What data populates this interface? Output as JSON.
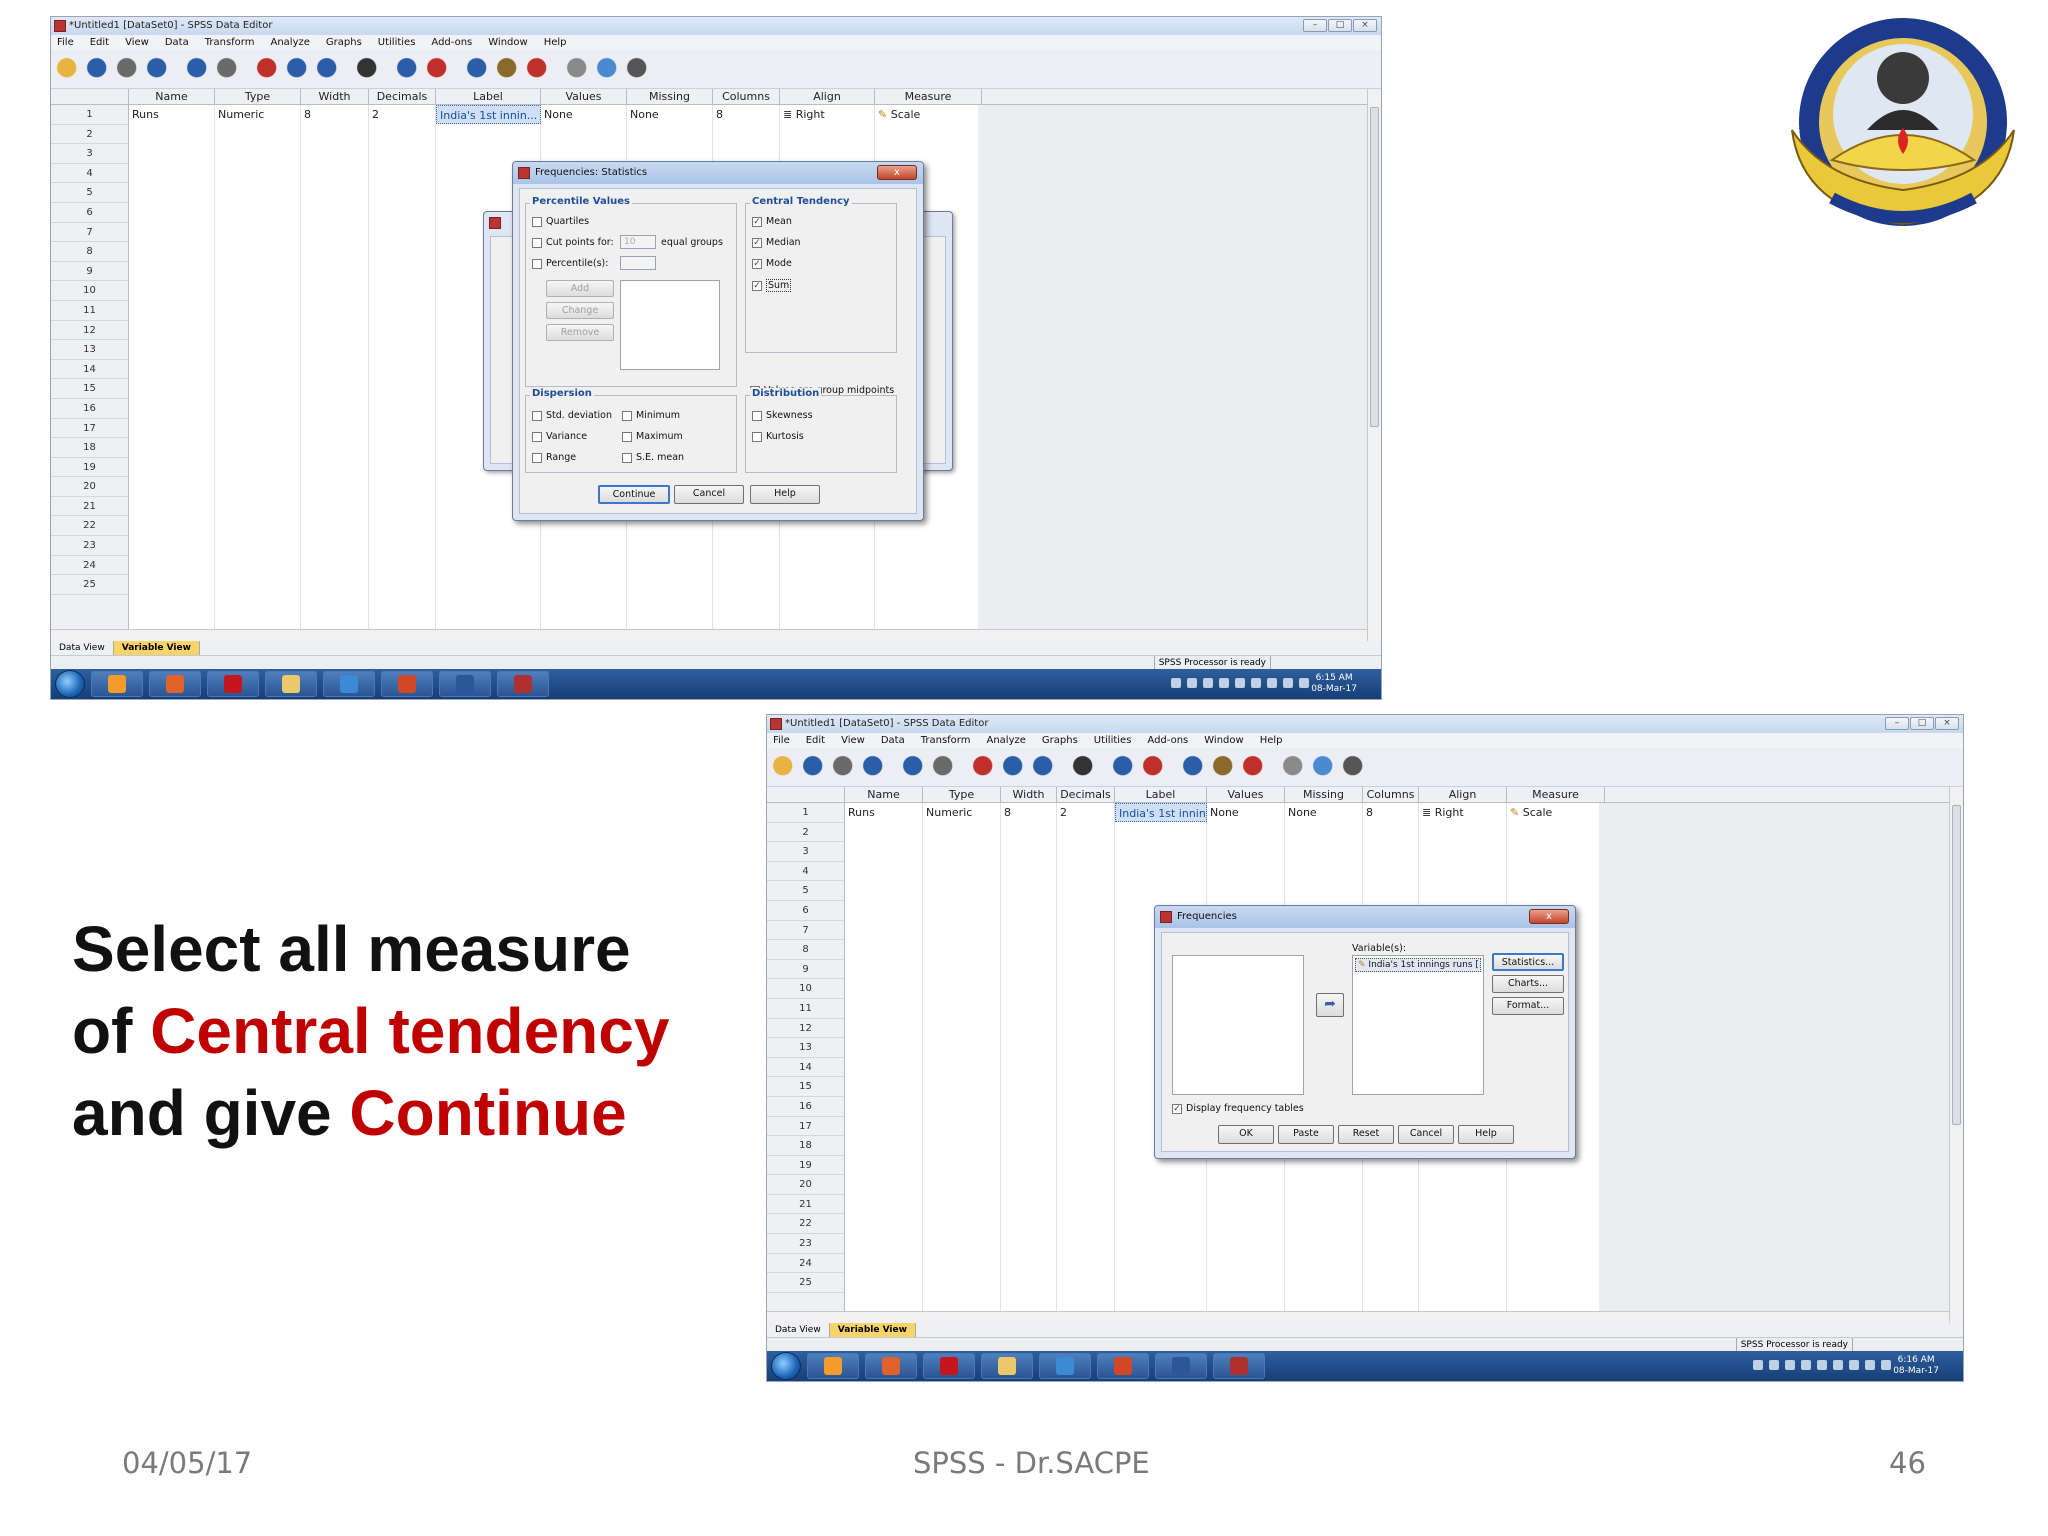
{
  "slide": {
    "caption": {
      "line1": "Select all measure",
      "line2_pre": "of ",
      "line2_red": "Central tendency",
      "line3_pre": "and give ",
      "line3_red": "Continue"
    },
    "footer": {
      "date": "04/05/17",
      "center": "SPSS - Dr.SACPE",
      "page": "46"
    },
    "colors": {
      "accent_red": "#c00000",
      "dialog_group_label": "#1f4e9a"
    }
  },
  "spss": {
    "title": "*Untitled1 [DataSet0] - SPSS Data Editor",
    "menus": [
      "File",
      "Edit",
      "View",
      "Data",
      "Transform",
      "Analyze",
      "Graphs",
      "Utilities",
      "Add-ons",
      "Window",
      "Help"
    ],
    "columns": [
      "Name",
      "Type",
      "Width",
      "Decimals",
      "Label",
      "Values",
      "Missing",
      "Columns",
      "Align",
      "Measure"
    ],
    "row1": [
      "Runs",
      "Numeric",
      "8",
      "2",
      "India's 1st innin...",
      "None",
      "None",
      "8",
      "Right",
      "Scale"
    ],
    "row_numbers": [
      "1",
      "2",
      "3",
      "4",
      "5",
      "6",
      "7",
      "8",
      "9",
      "10",
      "11",
      "12",
      "13",
      "14",
      "15",
      "16",
      "17",
      "18",
      "19",
      "20",
      "21",
      "22",
      "23",
      "24",
      "25"
    ],
    "tabs": {
      "data_view": "Data View",
      "variable_view": "Variable View"
    },
    "status": "SPSS  Processor is ready",
    "clock_top": {
      "time": "6:15 AM",
      "date": "08-Mar-17"
    },
    "clock_bottom": {
      "time": "6:16 AM",
      "date": "08-Mar-17"
    }
  },
  "stats_dialog": {
    "title": "Frequencies: Statistics",
    "percentile_group": "Percentile Values",
    "quartiles": "Quartiles",
    "cut_points": "Cut points for:",
    "cut_points_value": "10",
    "equal_groups": "equal groups",
    "percentiles": "Percentile(s):",
    "add": "Add",
    "change": "Change",
    "remove": "Remove",
    "central_group": "Central Tendency",
    "mean": "Mean",
    "median": "Median",
    "mode": "Mode",
    "sum": "Sum",
    "midpoints": "Values are group midpoints",
    "dispersion_group": "Dispersion",
    "std_dev": "Std. deviation",
    "minimum": "Minimum",
    "variance": "Variance",
    "maximum": "Maximum",
    "range": "Range",
    "se_mean": "S.E. mean",
    "distribution_group": "Distribution",
    "skewness": "Skewness",
    "kurtosis": "Kurtosis",
    "continue": "Continue",
    "cancel": "Cancel",
    "help": "Help",
    "close": "x"
  },
  "freq_dialog": {
    "title": "Frequencies",
    "variables_label": "Variable(s):",
    "variable_item": "India's 1st innings runs [...",
    "statistics": "Statistics...",
    "charts": "Charts...",
    "format": "Format...",
    "display_tables": "Display frequency tables",
    "ok": "OK",
    "paste": "Paste",
    "reset": "Reset",
    "cancel": "Cancel",
    "help": "Help",
    "close": "x"
  }
}
